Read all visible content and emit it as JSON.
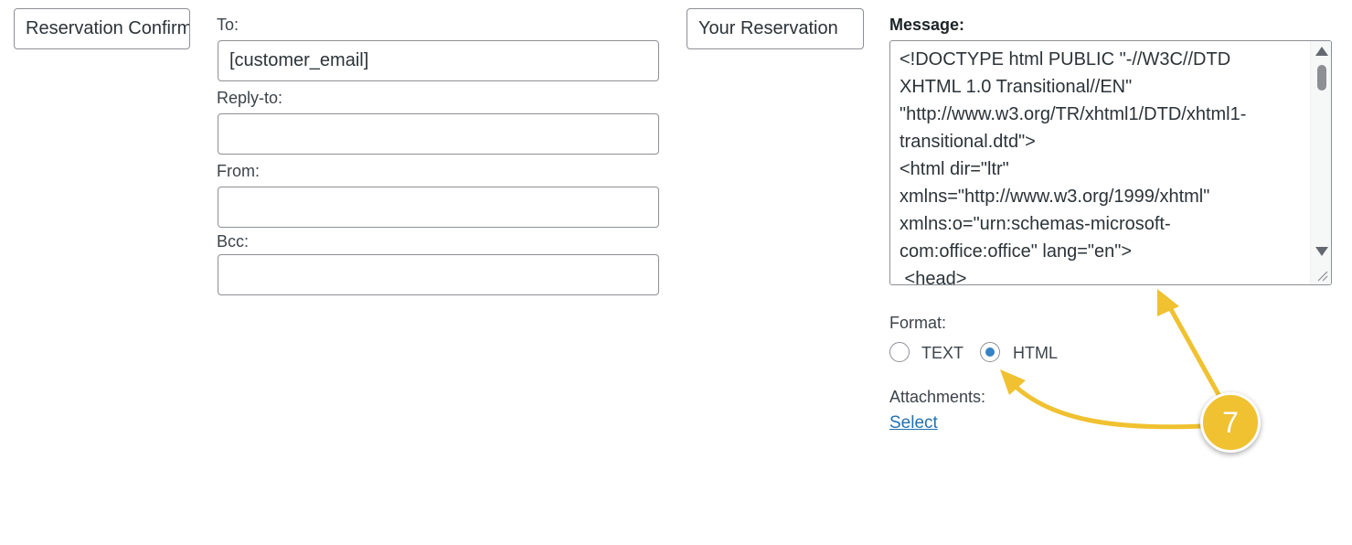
{
  "left": {
    "subject_input_value": "Reservation Confirmation"
  },
  "recipients": {
    "to_label": "To:",
    "to_value": "[customer_email]",
    "reply_to_label": "Reply-to:",
    "reply_to_value": "",
    "from_label": "From:",
    "from_value": "",
    "bcc_label": "Bcc:",
    "bcc_value": ""
  },
  "middle": {
    "title_input_value": "Your Reservation"
  },
  "message": {
    "label": "Message:",
    "content": "<!DOCTYPE html PUBLIC \"-//W3C//DTD\nXHTML 1.0 Transitional//EN\"\n\"http://www.w3.org/TR/xhtml1/DTD/xhtml1-\ntransitional.dtd\">\n<html dir=\"ltr\"\nxmlns=\"http://www.w3.org/1999/xhtml\"\nxmlns:o=\"urn:schemas-microsoft-\ncom:office:office\" lang=\"en\">\n <head>"
  },
  "format": {
    "label": "Format:",
    "options": [
      {
        "label": "TEXT",
        "checked": false
      },
      {
        "label": "HTML",
        "checked": true
      }
    ]
  },
  "attachments": {
    "label": "Attachments:",
    "select_link": "Select"
  },
  "annotation": {
    "step_number": "7",
    "color": "#f0c130"
  }
}
